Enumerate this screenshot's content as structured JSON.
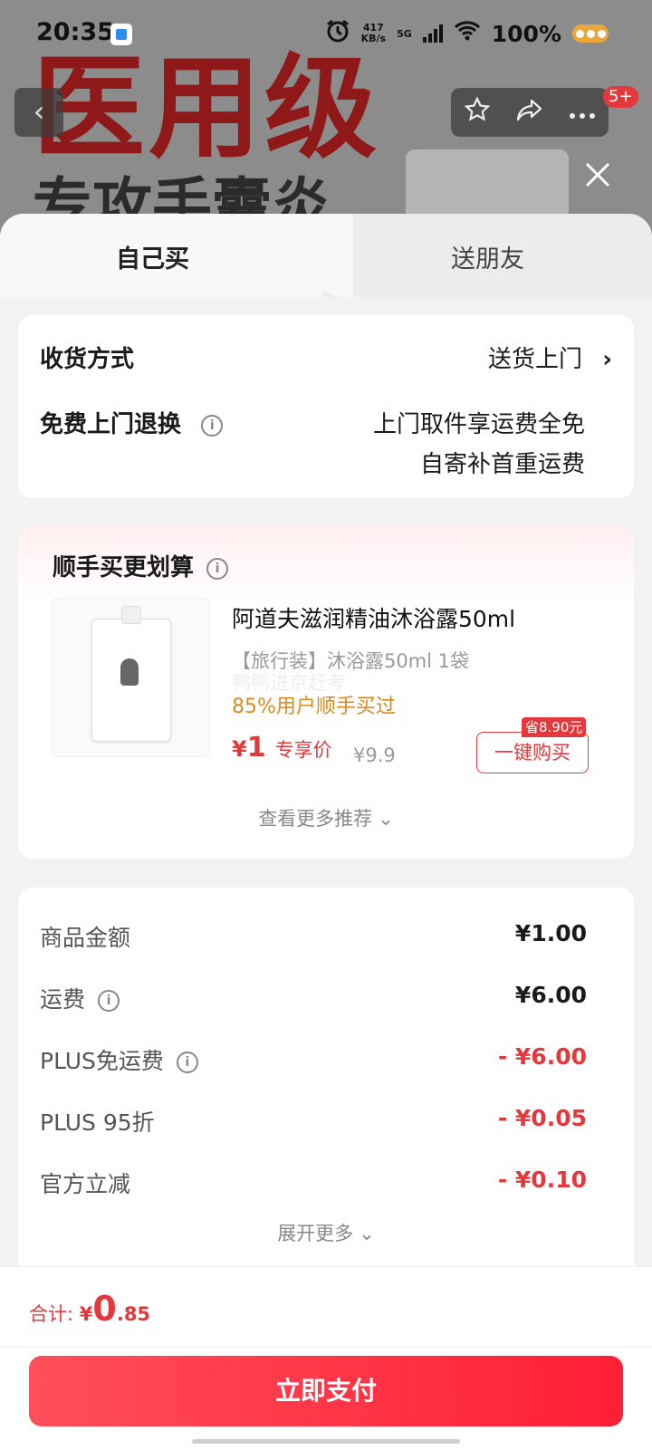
{
  "status_bar": {
    "time": "20:35",
    "speed_value": "417",
    "speed_unit": "KB/s",
    "network": "5G",
    "battery": "100%"
  },
  "background": {
    "headline": "医用级",
    "subline": "专攻手囊炎"
  },
  "nav": {
    "notification_badge": "5+"
  },
  "tabs": {
    "self": "自己买",
    "friend": "送朋友"
  },
  "delivery": {
    "method_label": "收货方式",
    "method_value": "送货上门",
    "return_label": "免费上门退换",
    "return_line1": "上门取件享运费全免",
    "return_line2": "自寄补首重运费"
  },
  "recommend": {
    "title": "顺手买更划算",
    "product_name": "阿道夫滋润精油沐浴露50ml",
    "spec": "【旅行装】沐浴露50ml 1袋",
    "ghost_text": "鸭鸭进京赶考",
    "bought": "85%用户顺手买过",
    "price_currency": "¥",
    "price": "1",
    "price_tag": "专享价",
    "original_price": "¥9.9",
    "buy_button": "一键购买",
    "save_badge": "省8.90元",
    "more": "查看更多推荐"
  },
  "fees": [
    {
      "label": "商品金额",
      "amount": "¥1.00"
    },
    {
      "label": "运费",
      "amount": "¥6.00"
    },
    {
      "label": "PLUS免运费",
      "amount": "- ¥6.00"
    },
    {
      "label": "PLUS 95折",
      "amount": "- ¥0.05"
    },
    {
      "label": "官方立减",
      "amount": "- ¥0.10"
    }
  ],
  "expand": "展开更多",
  "footer": {
    "total_label": "合计:",
    "currency": "¥",
    "total_int": "0",
    "total_dec": ".85",
    "pay_button": "立即支付"
  },
  "colors": {
    "accent": "#e4393c",
    "orange": "#d98a1e"
  },
  "icons": [
    "back-icon",
    "star-icon",
    "share-icon",
    "more-icon",
    "close-icon",
    "info-icon",
    "chevron-right-icon",
    "chevron-down-icon"
  ]
}
